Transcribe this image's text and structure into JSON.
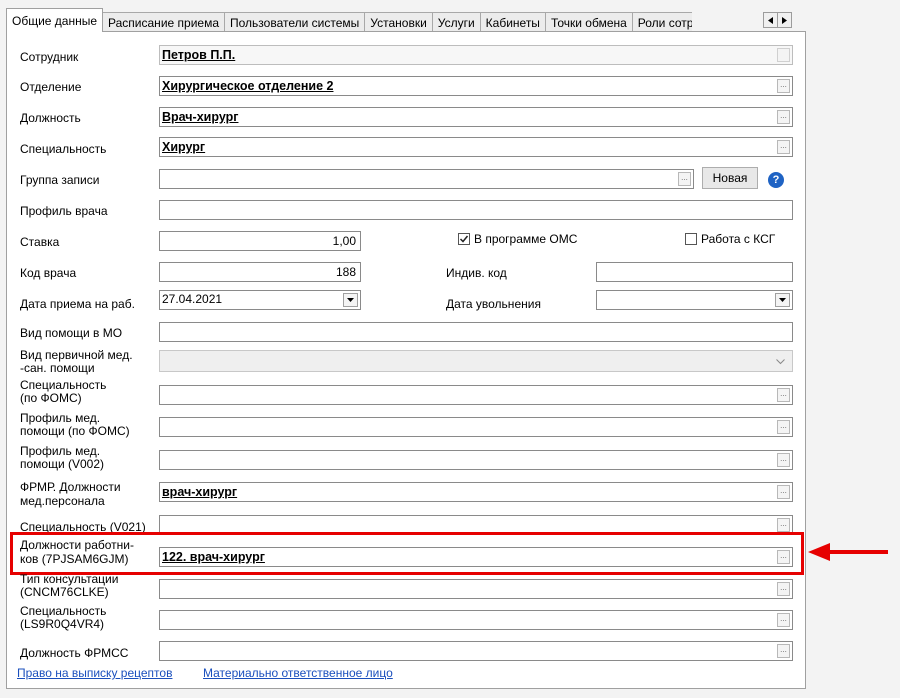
{
  "tabs": [
    "Общие данные",
    "Расписание приема",
    "Пользователи системы",
    "Установки",
    "Услуги",
    "Кабинеты",
    "Точки обмена",
    "Роли сотр"
  ],
  "form": {
    "employee": {
      "label": "Сотрудник",
      "value": "Петров П.П."
    },
    "department": {
      "label": "Отделение",
      "value": "Хирургическое отделение 2"
    },
    "position": {
      "label": "Должность",
      "value": "Врач-хирург"
    },
    "specialty": {
      "label": "Специальность",
      "value": "Хирург"
    },
    "record_group": {
      "label": "Группа записи",
      "value": "",
      "new_button": "Новая"
    },
    "doctor_profile": {
      "label": "Профиль врача",
      "value": ""
    },
    "rate": {
      "label": "Ставка",
      "value": "1,00"
    },
    "oms": {
      "label": "В программе ОМС",
      "checked": true
    },
    "ksg": {
      "label": "Работа с КСГ",
      "checked": false
    },
    "doctor_code": {
      "label": "Код врача",
      "value": "188"
    },
    "indiv_code": {
      "label": "Индив. код",
      "value": ""
    },
    "hire_date": {
      "label": "Дата приема на раб.",
      "value": "27.04.2021"
    },
    "dismissal_date": {
      "label": "Дата увольнения",
      "value": ""
    },
    "help_type": {
      "label": "Вид помощи в МО",
      "value": ""
    },
    "primary_care": {
      "label_line1": "Вид первичной мед.",
      "label_line2": "-сан. помощи",
      "value": ""
    },
    "specialty_foms": {
      "label_line1": "Специальность",
      "label_line2": "(по ФОМС)",
      "value": ""
    },
    "profile_foms": {
      "label_line1": "Профиль  мед.",
      "label_line2": "помощи (по ФОМС)",
      "value": ""
    },
    "profile_v002": {
      "label_line1": "Профиль  мед.",
      "label_line2": "помощи (V002)",
      "value": ""
    },
    "frmr_position": {
      "label_line1": "ФРМР. Должности",
      "label_line2": "мед.персонала",
      "value": "врач-хирург"
    },
    "specialty_v021": {
      "label": "Специальность (V021)",
      "value": ""
    },
    "worker_positions": {
      "label_line1": "Должности работни-",
      "label_line2": "ков (7PJSAM6GJM)",
      "value": "122. врач-хирург"
    },
    "consult_type": {
      "label_line1": "Тип консультации",
      "label_line2": "(CNCM76CLKE)",
      "value": ""
    },
    "specialty_ls": {
      "label_line1": "Специальность",
      "label_line2": "(LS9R0Q4VR4)",
      "value": ""
    },
    "frmss_position": {
      "label": "Должность ФРМСС",
      "value": ""
    }
  },
  "links": {
    "prescription": "Право на выписку рецептов",
    "responsible": "Материально ответственное лицо"
  },
  "icons": {
    "ellipsis": "...",
    "help": "?"
  },
  "colors": {
    "highlight": "#e60000",
    "link": "#1a4fbd",
    "help": "#1f63c4"
  }
}
